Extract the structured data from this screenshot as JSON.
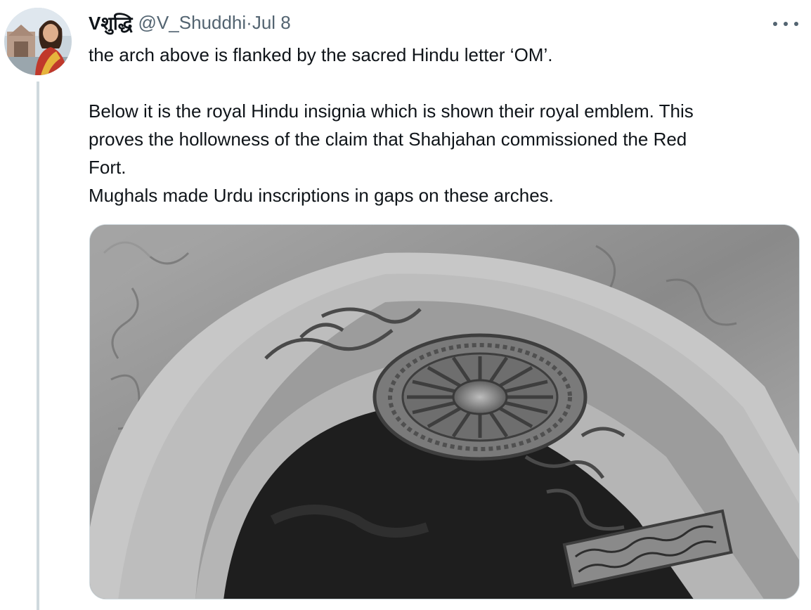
{
  "tweet": {
    "author": {
      "display_name": "Vशुद्धि",
      "handle": "@V_Shuddhi",
      "separator": "·",
      "date": "Jul 8"
    },
    "text_lines": [
      "the arch above is flanked by the sacred Hindu letter ‘OM’.",
      "",
      "Below it is the royal Hindu insignia which is shown their royal emblem. This",
      "proves the hollowness of the claim that Shahjahan commissioned the Red",
      "Fort.",
      "Mughals made Urdu inscriptions in gaps on these arches."
    ],
    "icons": {
      "avatar": "profile-photo",
      "more": "more-horizontal-icon"
    },
    "colors": {
      "text": "#0f1419",
      "muted": "#536471",
      "thread_line": "#cfd9de"
    }
  }
}
